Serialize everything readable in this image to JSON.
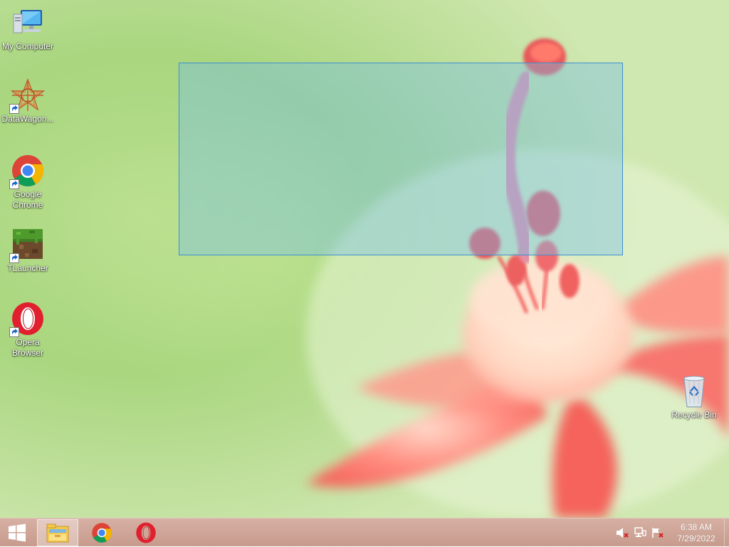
{
  "desktop": {
    "icons": [
      {
        "label": "My Computer",
        "icon": "computer-icon"
      },
      {
        "label": "DataWagon...",
        "icon": "datawagon-icon"
      },
      {
        "label": "Google Chrome",
        "icon": "chrome-icon"
      },
      {
        "label": "TLauncher",
        "icon": "minecraft-grass-block-icon"
      },
      {
        "label": "Opera Browser",
        "icon": "opera-icon"
      },
      {
        "label": "Recycle Bin",
        "icon": "recycle-bin-icon"
      }
    ],
    "selection_rectangle": "drag-selection-marquee"
  },
  "taskbar": {
    "start": {
      "icon": "windows-logo-icon"
    },
    "pinned": [
      {
        "name": "File Explorer",
        "icon": "file-explorer-icon",
        "active": true
      },
      {
        "name": "Google Chrome",
        "icon": "chrome-icon",
        "active": false
      },
      {
        "name": "Opera",
        "icon": "opera-icon",
        "active": false
      }
    ],
    "tray": {
      "icons": [
        "volume-muted-icon",
        "network-icon",
        "action-center-flag-icon"
      ],
      "clock": {
        "time": "6:38 AM",
        "date": "7/29/2022"
      }
    }
  },
  "colors": {
    "taskbar": "#cfa697",
    "selection_fill": "#78bee6",
    "selection_border": "#3d8fd1",
    "wallpaper_green": "#b9df8e",
    "flower_pink": "#f26f6a"
  }
}
